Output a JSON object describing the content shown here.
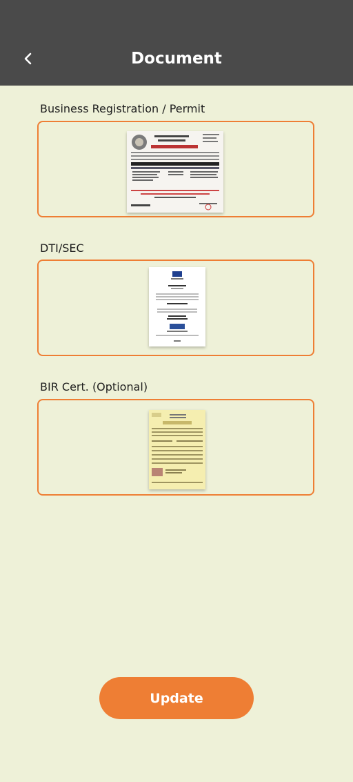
{
  "header": {
    "title": "Document",
    "back_icon": "chevron-left-icon"
  },
  "documents": [
    {
      "label": "Business Registration / Permit"
    },
    {
      "label": "DTI/SEC"
    },
    {
      "label": "BIR Cert. (Optional)"
    }
  ],
  "update_label": "Update",
  "colors": {
    "accent": "#ee7e34",
    "header_bg": "#4a4a4a",
    "page_bg": "#eef1d8"
  }
}
